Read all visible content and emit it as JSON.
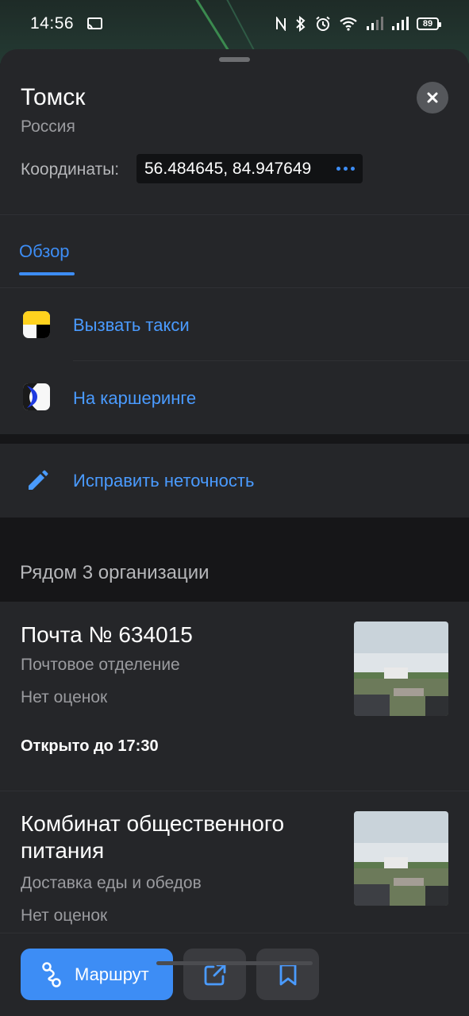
{
  "status_bar": {
    "time": "14:56",
    "battery": "89",
    "icons": [
      "cast-icon",
      "nfc-icon",
      "bluetooth-icon",
      "alarm-icon",
      "wifi-icon",
      "signal-icon",
      "signal-icon",
      "battery-icon"
    ]
  },
  "place": {
    "title": "Томск",
    "country": "Россия",
    "coords_label": "Координаты:",
    "coords_value": "56.484645, 84.947649"
  },
  "tabs": [
    {
      "label": "Обзор",
      "active": true
    }
  ],
  "actions": [
    {
      "label": "Вызвать такси",
      "icon": "taxi-icon"
    },
    {
      "label": "На каршеринге",
      "icon": "carsharing-icon"
    }
  ],
  "fix": {
    "label": "Исправить неточность",
    "icon": "pencil-icon"
  },
  "nearby": {
    "title": "Рядом 3 организации",
    "orgs": [
      {
        "name": "Почта № 634015",
        "category": "Почтовое отделение",
        "rating": "Нет оценок",
        "hours": "Открыто до 17:30"
      },
      {
        "name": "Комбинат общественного питания",
        "category": "Доставка еды и обедов",
        "rating": "Нет оценок"
      }
    ]
  },
  "bottom_bar": {
    "route_label": "Маршрут"
  },
  "colors": {
    "accent": "#3d8df5",
    "sheet_bg": "#252629",
    "section_gap": "#161618"
  }
}
